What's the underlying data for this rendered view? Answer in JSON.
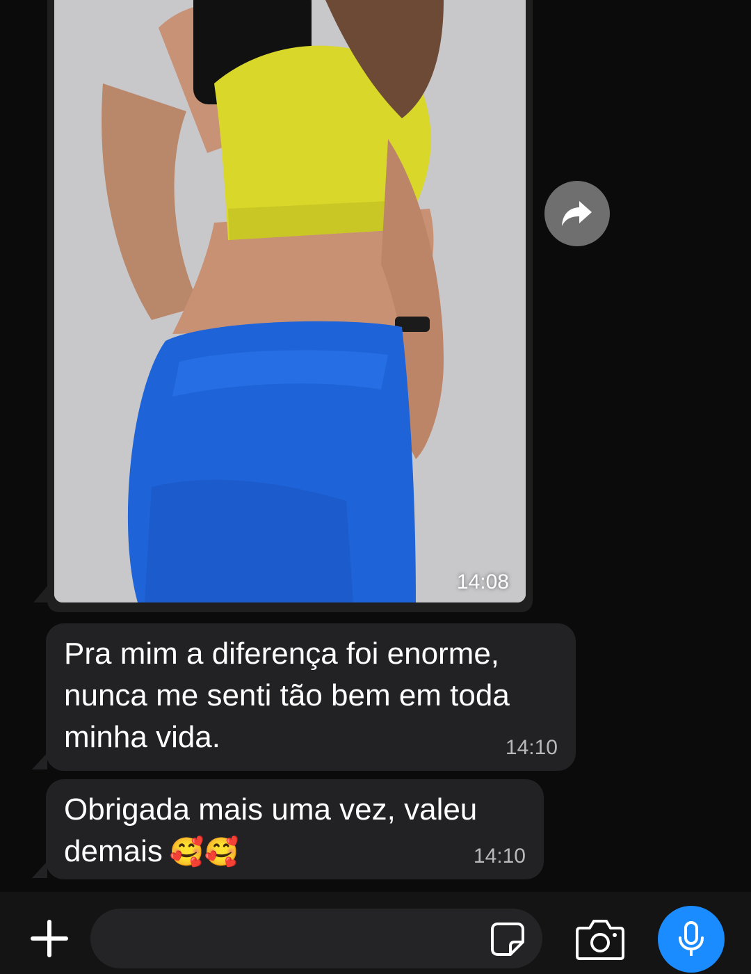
{
  "messages": [
    {
      "type": "image",
      "time": "14:08",
      "image_icon": "photo-of-person-in-yellow-top-and-blue-leggings"
    },
    {
      "type": "text",
      "text": "Pra mim a diferença foi enorme,\nnunca me senti tão bem em toda\nminha vida.",
      "time": "14:10"
    },
    {
      "type": "text",
      "text": "Obrigada mais uma vez, valeu\ndemais",
      "emoji": "🥰🥰",
      "time": "14:10"
    }
  ],
  "actions": {
    "forward_icon": "forward-arrow-icon"
  },
  "composer": {
    "plus_icon": "plus-icon",
    "placeholder": "",
    "sticker_icon": "sticker-icon",
    "camera_icon": "camera-icon",
    "mic_icon": "microphone-icon"
  },
  "colors": {
    "background": "#0b0b0b",
    "bubble": "#222224",
    "mic_button": "#1a8cff",
    "forward_button": "#6f6f6f"
  }
}
